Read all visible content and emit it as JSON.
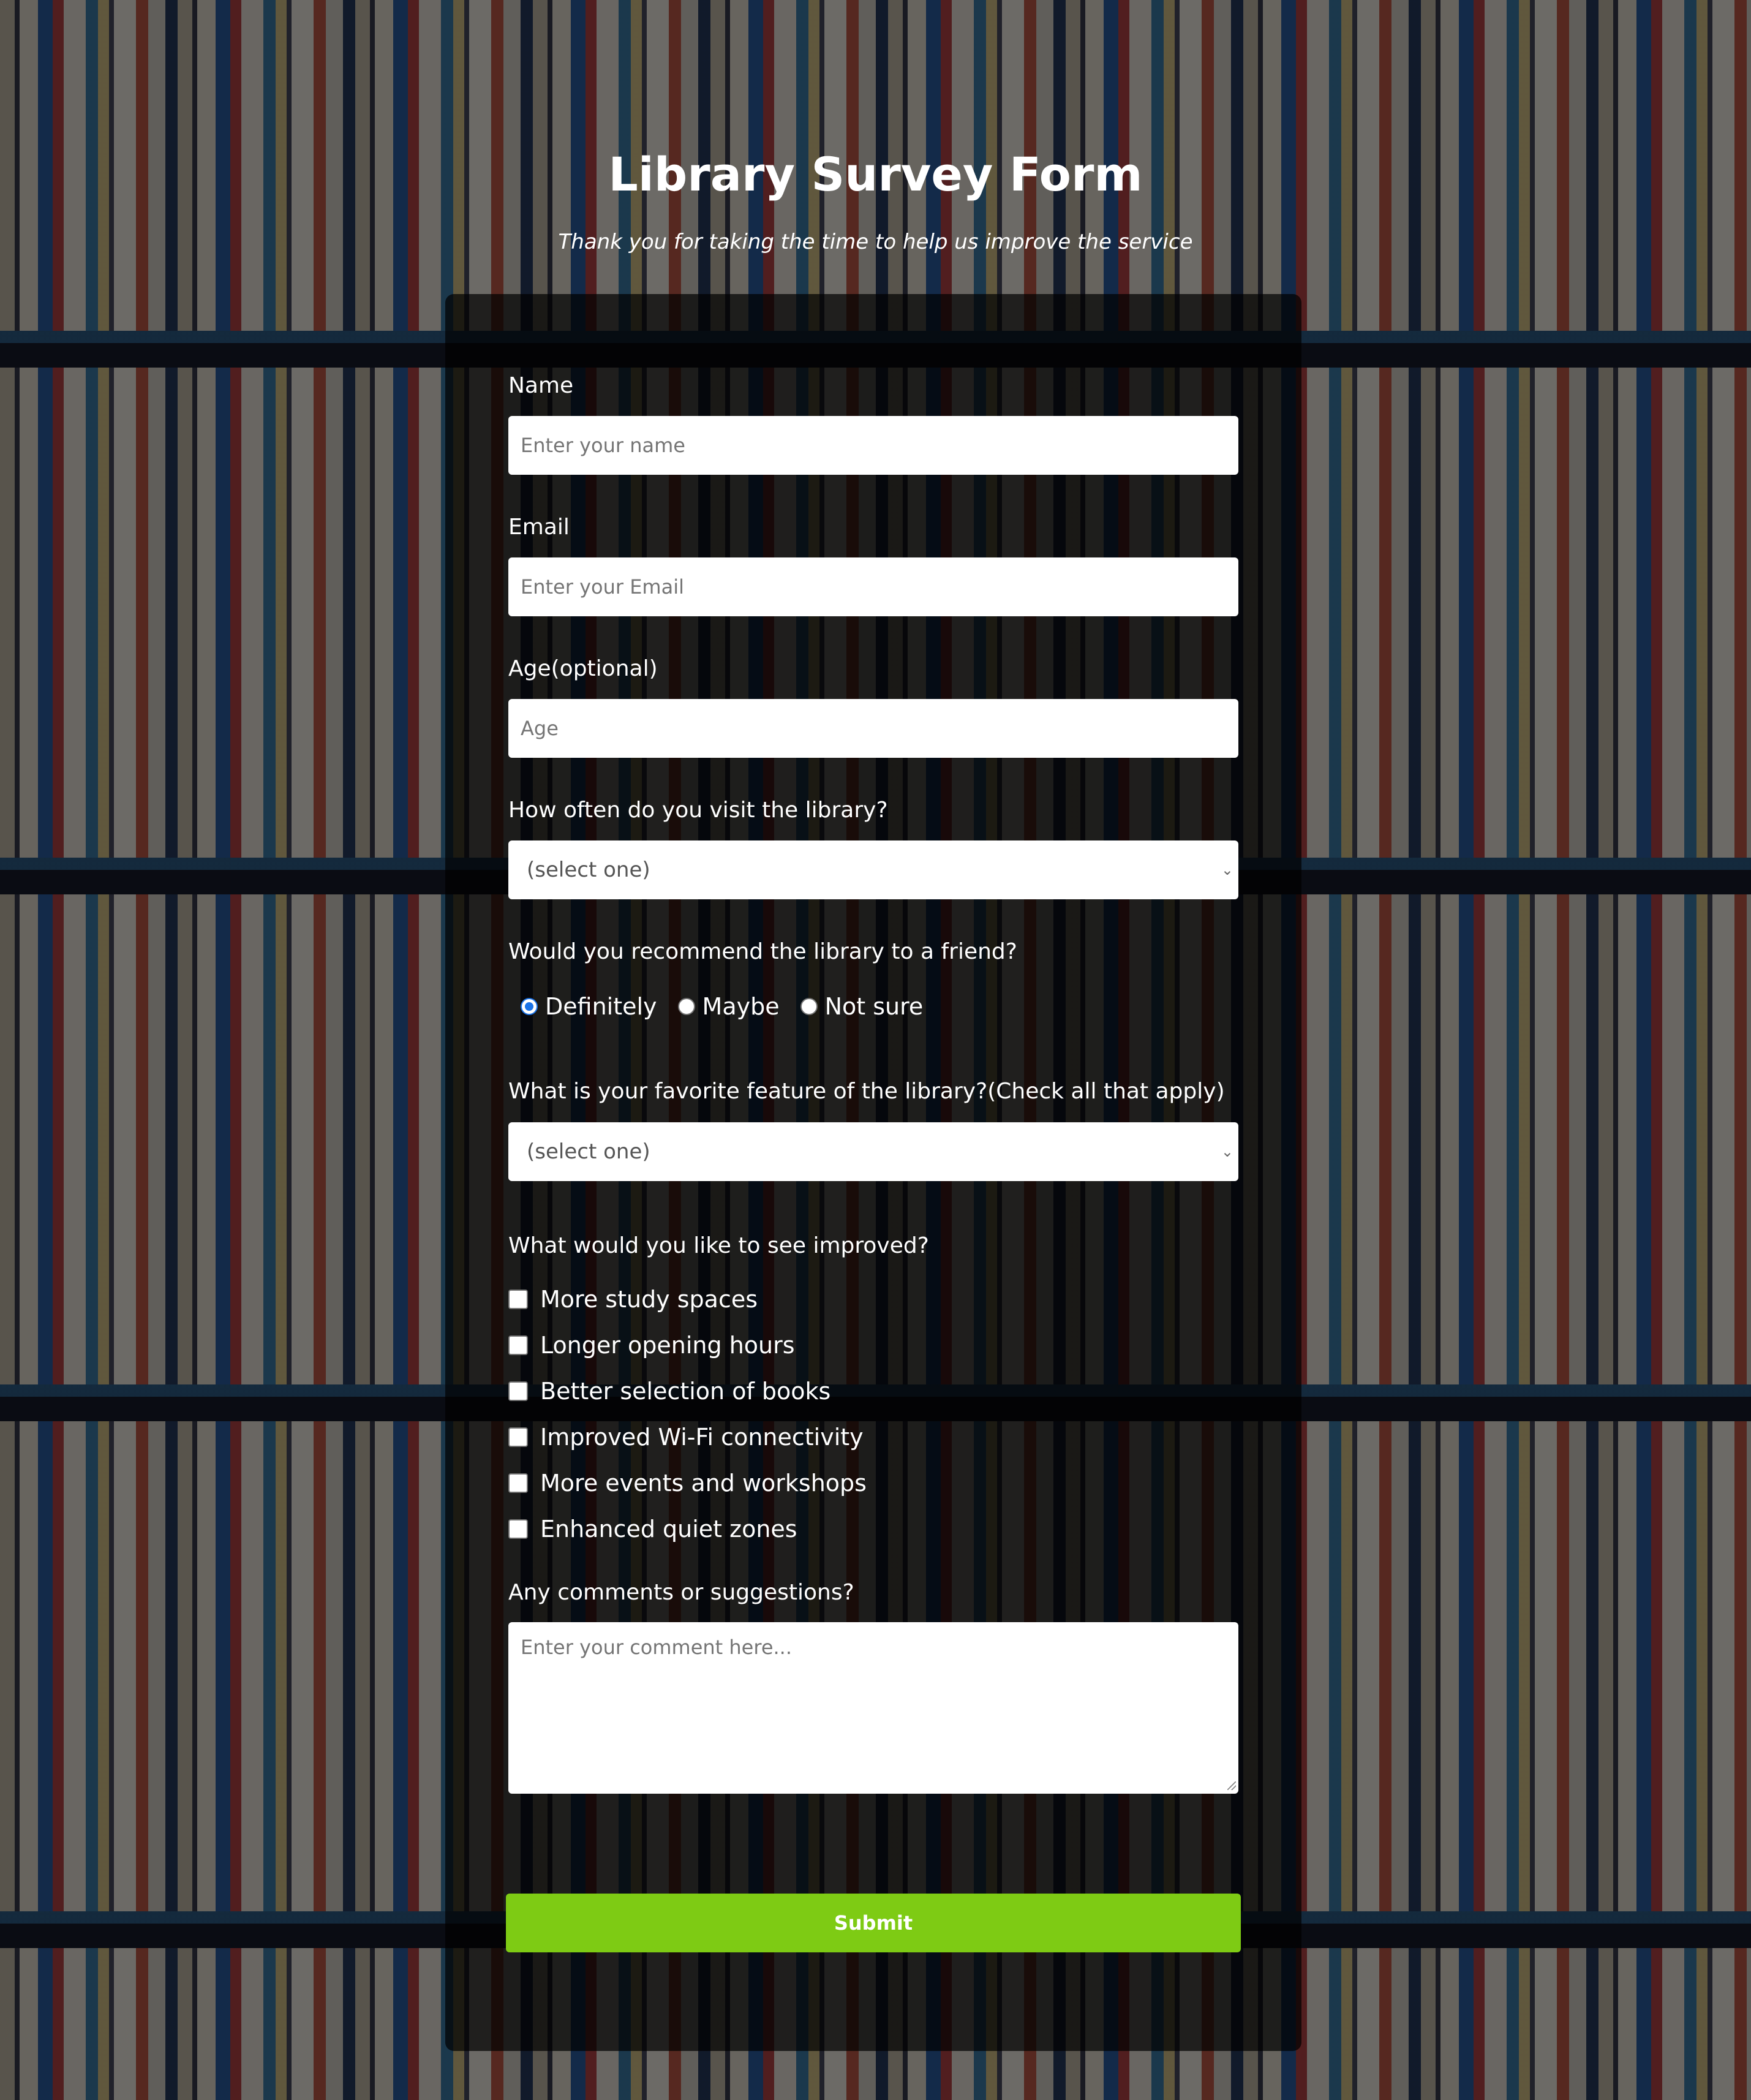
{
  "header": {
    "title": "Library Survey Form",
    "subtitle": "Thank you for taking the time to help us improve the service"
  },
  "form": {
    "name": {
      "label": "Name",
      "placeholder": "Enter your name",
      "value": ""
    },
    "email": {
      "label": "Email",
      "placeholder": "Enter your Email",
      "value": ""
    },
    "age": {
      "label": "Age(optional)",
      "placeholder": "Age",
      "value": ""
    },
    "visit_frequency": {
      "label": "How often do you visit the library?",
      "selected": "(select one)",
      "chevron_icon": "chevron-down-icon"
    },
    "recommend": {
      "label": "Would you recommend the library to a friend?",
      "options": [
        {
          "label": "Definitely",
          "checked": true
        },
        {
          "label": "Maybe",
          "checked": false
        },
        {
          "label": "Not sure",
          "checked": false
        }
      ]
    },
    "favorite_feature": {
      "label": "What is your favorite feature of the library?(Check all that apply)",
      "selected": "(select one)",
      "chevron_icon": "chevron-down-icon"
    },
    "improvements": {
      "label": "What would you like to see improved?",
      "options": [
        {
          "label": "More study spaces",
          "checked": false
        },
        {
          "label": "Longer opening hours",
          "checked": false
        },
        {
          "label": "Better selection of books",
          "checked": false
        },
        {
          "label": "Improved Wi-Fi connectivity",
          "checked": false
        },
        {
          "label": "More events and workshops",
          "checked": false
        },
        {
          "label": "Enhanced quiet zones",
          "checked": false
        }
      ]
    },
    "comments": {
      "label": "Any comments or suggestions?",
      "placeholder": "Enter your comment here..."
    },
    "submit_label": "Submit"
  },
  "colors": {
    "submit_button": "#7ecb14",
    "radio_checked": "#1a73e8",
    "card_overlay": "rgba(0,0,0,0.70)"
  }
}
